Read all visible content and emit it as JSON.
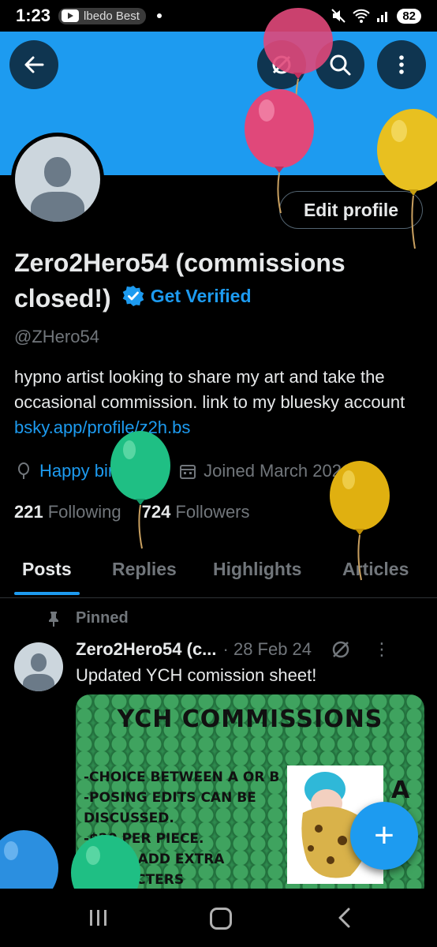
{
  "status_bar": {
    "time": "1:23",
    "media_text": "lbedo Best",
    "battery": "82"
  },
  "profile": {
    "name": "Zero2Hero54 (commissions closed!)",
    "get_verified_label": "Get Verified",
    "handle": "@ZHero54",
    "edit_profile_label": "Edit profile",
    "bio_text": "hypno artist looking to share my art and take the occasional commission. link to my bluesky account ",
    "bio_link": "bsky.app/profile/z2h.bs",
    "birthday_label": "Happy birthday!",
    "joined_label": "Joined March 2021",
    "following_count": "221",
    "following_label": "Following",
    "followers_count": "724",
    "followers_label": "Followers"
  },
  "tabs": [
    "Posts",
    "Replies",
    "Highlights",
    "Articles"
  ],
  "pinned_post": {
    "pinned_label": "Pinned",
    "author": "Zero2Hero54 (c...",
    "date": "· 28 Feb 24",
    "text": "Updated YCH comission sheet!",
    "image": {
      "title": "YCH COMMISSIONS",
      "lines": [
        "-CHOICE BETWEEN A OR B",
        "-POSING EDITS CAN BE",
        "DISCUSSED.",
        "-$20 PER PIECE.",
        "-$5 TO ADD EXTRA",
        "CHARACTERS"
      ],
      "option_letter": "A"
    }
  },
  "fab_label": "+",
  "colors": {
    "accent": "#1d9bf0",
    "banner": "#1d9bf0",
    "background": "#000000",
    "muted_text": "#71767b"
  }
}
